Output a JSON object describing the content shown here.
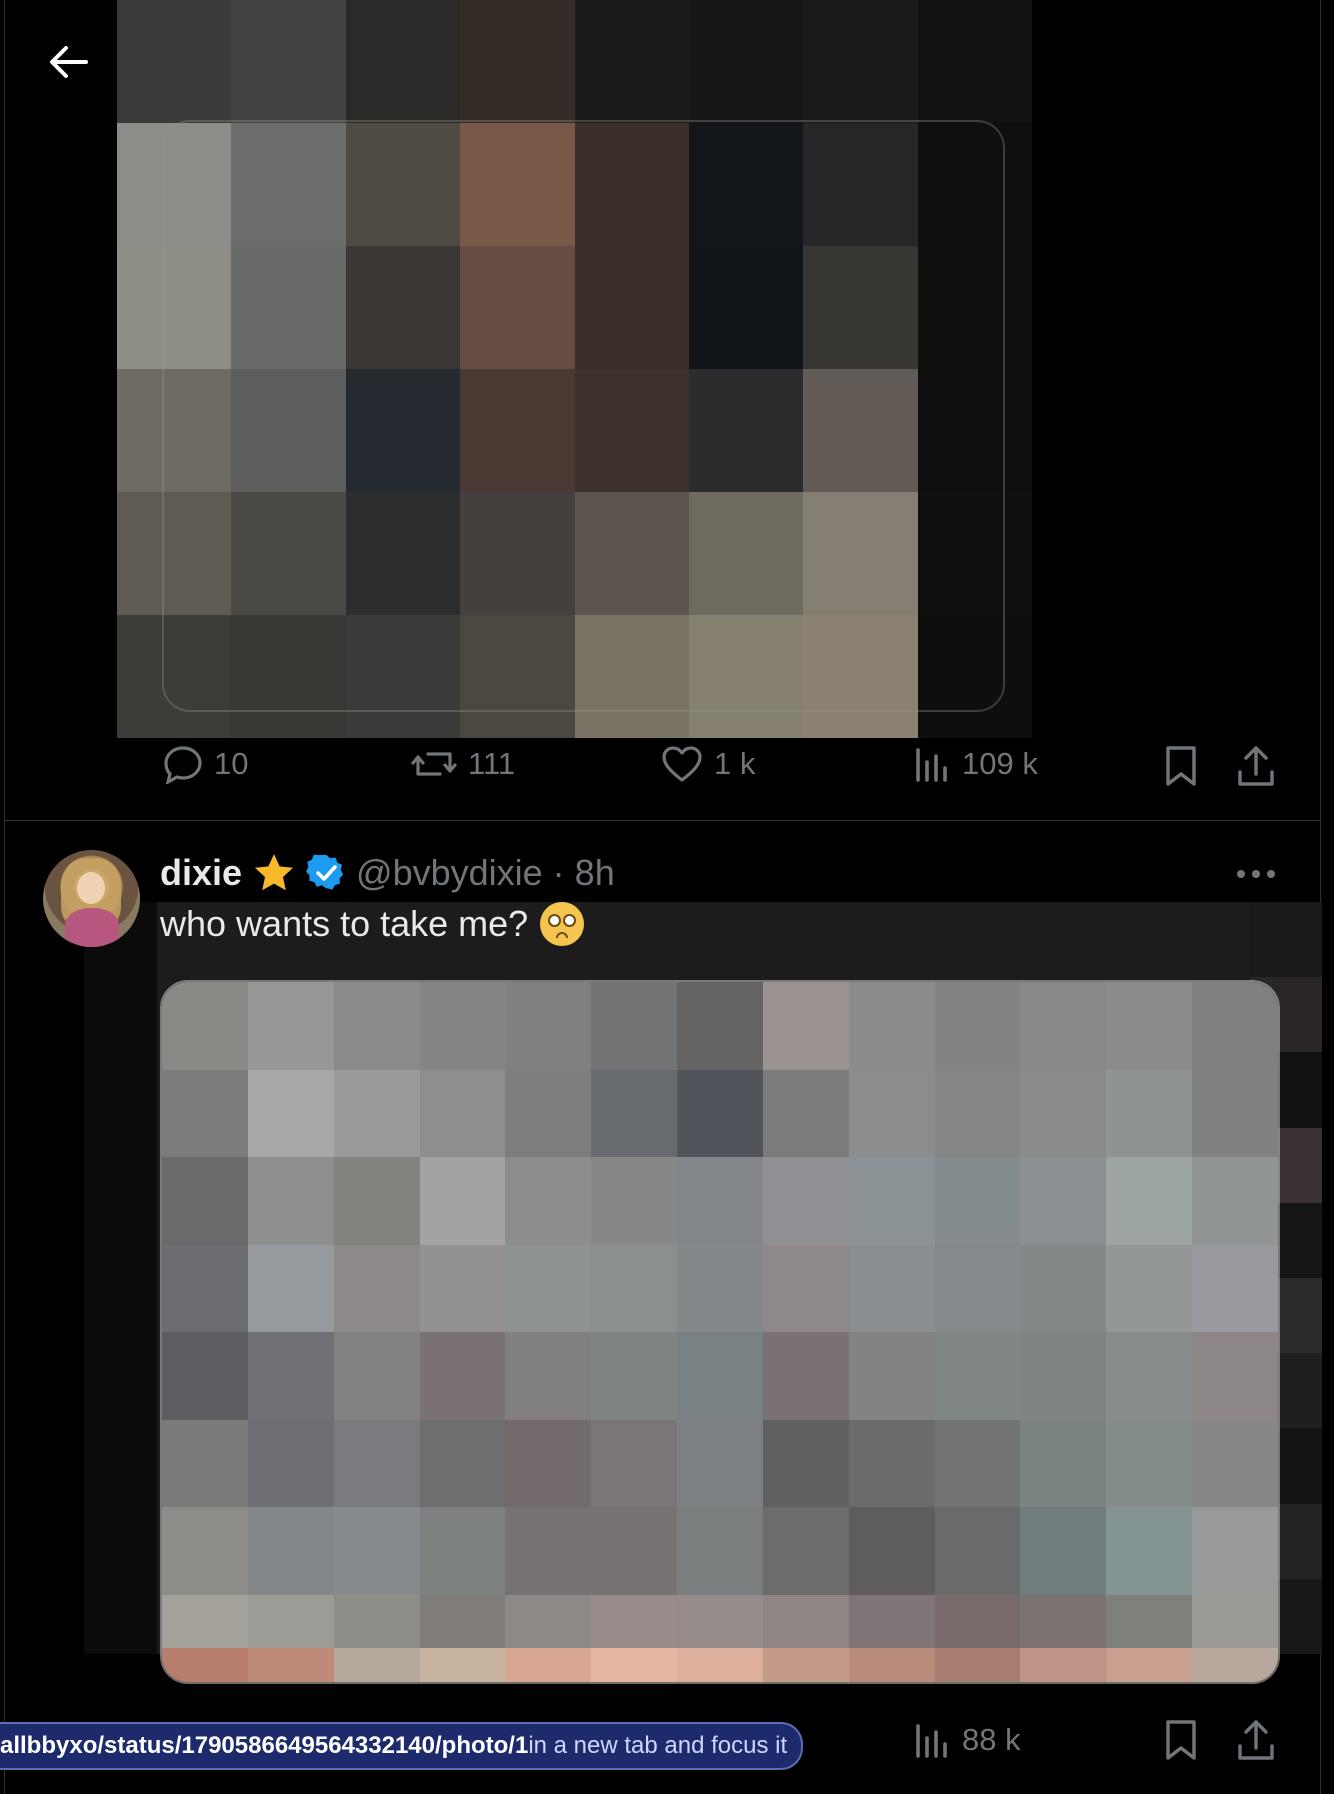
{
  "colors": {
    "background": "#000000",
    "text_primary": "#e7e9ea",
    "text_secondary": "#71767b",
    "verified": "#1d9bf0",
    "star": "#f7b928",
    "divider": "#2f3336",
    "status_bg": "#1d2a6b"
  },
  "nav": {
    "back_icon": "arrow-left-icon"
  },
  "post1": {
    "media": {
      "icon": "image-pixelated"
    },
    "actions": {
      "replies": "10",
      "reposts": "111",
      "likes": "1 k",
      "views": "109 k"
    }
  },
  "post2": {
    "author": {
      "name": "dixie",
      "badge_icon": "star-icon",
      "verified_icon": "verified-badge-icon",
      "handle_time": "@bvbydixie · 8h"
    },
    "text": "who wants to take me?",
    "emoji": "pleading-face",
    "media": {
      "icon": "image-pixelated"
    },
    "actions": {
      "views": "88 k"
    }
  },
  "status_bar": {
    "url": "allbbyxo/status/1790586649564332140/photo/1",
    "suffix": " in a new tab and focus it"
  }
}
